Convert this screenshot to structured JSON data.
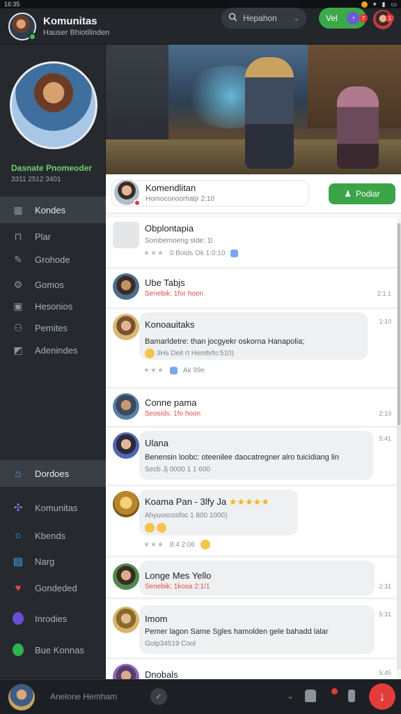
{
  "status_bar": {
    "time": "16:35"
  },
  "header": {
    "title": "Komunitas",
    "subtitle": "Hauser Bhiotilinden",
    "search_placeholder": "Hepahon",
    "action_label": "Vel",
    "action_badge": "7",
    "profile_badge": "1"
  },
  "sidebar": {
    "profile_name": "Dasnate Pnomeoder",
    "profile_sub": "3311 2512 3401",
    "items": [
      {
        "label": "Kondes",
        "icon": "grid-icon"
      },
      {
        "label": "Plar",
        "icon": "bag-icon"
      },
      {
        "label": "Grohode",
        "icon": "pencil-icon"
      },
      {
        "label": "Gomos",
        "icon": "gear-icon"
      },
      {
        "label": "Hesonios",
        "icon": "card-icon"
      },
      {
        "label": "Pemites",
        "icon": "people-icon"
      },
      {
        "label": "Adenindes",
        "icon": "box-icon"
      }
    ],
    "bottom_items": [
      {
        "label": "Dordoes",
        "icon": "home-icon"
      },
      {
        "label": "Komunitas",
        "icon": "share-icon"
      },
      {
        "label": "Kbends",
        "icon": "search-icon"
      },
      {
        "label": "Narg",
        "icon": "board-icon"
      },
      {
        "label": "Gondeded",
        "icon": "heart-icon"
      },
      {
        "label": "Inrodies",
        "icon": "circle-icon"
      },
      {
        "label": "Bue Konnas",
        "icon": "circle-icon"
      }
    ]
  },
  "pinned": {
    "name": "Komendlitan",
    "sub": "Homoconoorhatjr 2:10",
    "follow_label": "Podiar"
  },
  "posts": [
    {
      "name": "Obplontapia",
      "meta": "Sombemoeng stde: 1l",
      "reactions": "0 Boids  Ok 1:0:10",
      "time": ""
    },
    {
      "name": "Ube Tabjs",
      "meta": "Senebik: 1for hoen",
      "time": "2:1:1"
    },
    {
      "name": "Konoauitaks",
      "body": "Bamarldetre: than jocgyekr oskorna Hanapolia;",
      "body2": "3Hs Deit rt Hembrfo:510)",
      "reactions": "Ak   99e",
      "time": "1:10"
    },
    {
      "name": "Conne pama",
      "meta": "Seosids: 1fo hoon",
      "time": "2:10"
    },
    {
      "name": "Ulana",
      "body": "Benensin loobc: oteenilee daocatregner alro tuicidiang lin",
      "body2": "Secb Jj 0000 1 1 600",
      "time": "5:41"
    },
    {
      "name": "Koama Pan - 3lfy  Ja",
      "body2": "Ahyuoscosfoc 1 800  1000)",
      "reactions": "8:4   2:06",
      "time": ""
    },
    {
      "name": "Longe Mes Yello",
      "meta": "Senebik: 1kosa  2:1/1",
      "time": "2:31"
    },
    {
      "name": "Imom",
      "body": "Pemer lagon Same Sgles hamolden gele bahadd lalar",
      "body2": "Gotp34519 Cool",
      "time": "5:31"
    },
    {
      "name": "Dnobals",
      "time": "5:45"
    }
  ],
  "composer": {
    "placeholder": "Anelone Hemham"
  },
  "colors": {
    "accent_green": "#3da84a",
    "accent_red": "#e23c3c"
  }
}
